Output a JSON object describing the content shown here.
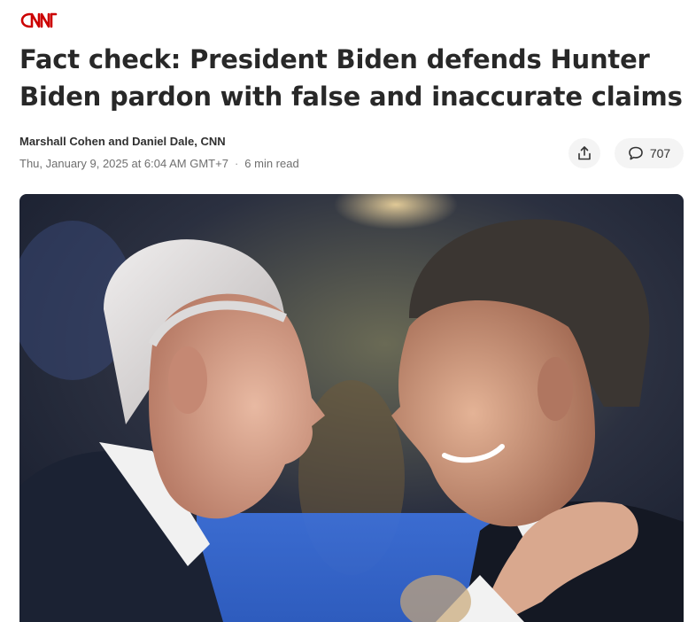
{
  "brand": {
    "logo_text": "CNN",
    "color": "#cc0000"
  },
  "article": {
    "title": "Fact check: President Biden defends Hunter Biden pardon with false and inaccurate claims",
    "authors": "Marshall Cohen and Daniel Dale, CNN",
    "date": "Thu, January 9, 2025 at 6:04 AM GMT+7",
    "separator": "·",
    "read_time": "6 min read"
  },
  "actions": {
    "share_icon": "share-icon",
    "comment_icon": "comment-icon",
    "comment_count": "707"
  },
  "hero_image": {
    "description_icon": "photo"
  }
}
